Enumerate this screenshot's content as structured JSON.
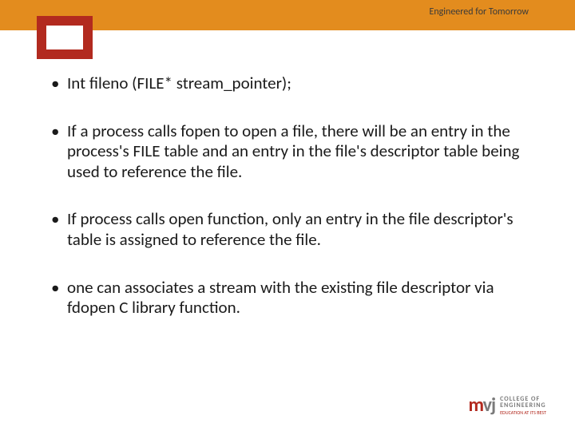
{
  "header": {
    "tagline": "Engineered for Tomorrow"
  },
  "bullets": [
    "Int fileno (FILE* stream_pointer);",
    "If a process calls fopen to open a file, there will be an entry in the process's FILE table and an entry in the file's descriptor table being used to reference the file.",
    "If process calls open function, only an entry in the file descriptor's table is assigned to reference the file.",
    "one can associates a stream with the existing file descriptor via fdopen C library function."
  ],
  "logo": {
    "mark_m": "m",
    "mark_vj": "vj",
    "line1": "COLLEGE OF",
    "line2": "ENGINEERING",
    "line3": "EDUCATION AT ITS BEST"
  }
}
